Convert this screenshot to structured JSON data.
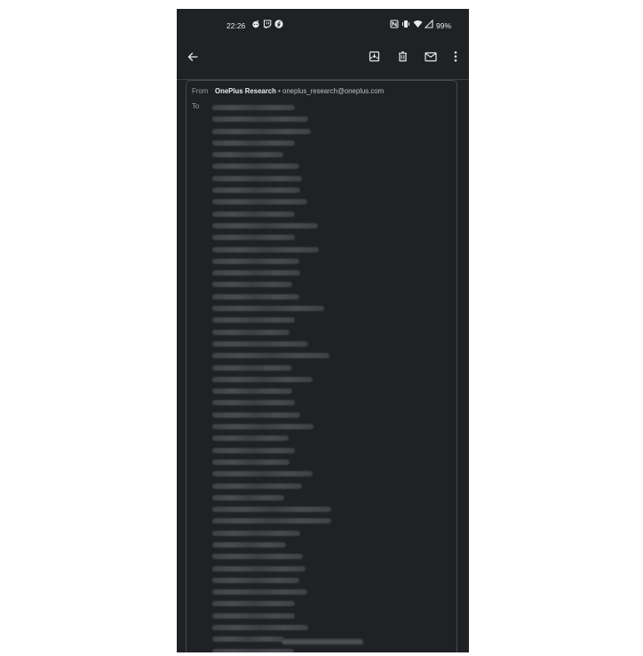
{
  "status_bar": {
    "time": "22:26",
    "battery": "99%",
    "left_icons": [
      "reddit-icon",
      "twitch-icon",
      "shazam-icon"
    ],
    "right_icons": [
      "nfc-icon",
      "vibrate-icon",
      "wifi-icon",
      "cell-signal-icon"
    ]
  },
  "app_bar": {
    "actions": [
      "back-arrow-icon",
      "archive-icon",
      "delete-icon",
      "mark-unread-icon",
      "more-vert-icon"
    ]
  },
  "details": {
    "from_label": "From",
    "sender_name": "OnePlus Research",
    "separator": "•",
    "sender_email": "oneplus_research@oneplus.com",
    "to_label": "To",
    "recipients_note": "redacted",
    "recipient_widths": [
      0.62,
      0.72,
      0.74,
      0.62,
      0.53,
      0.65,
      0.67,
      0.66,
      0.71,
      0.62,
      0.79,
      0.62,
      0.8,
      0.65,
      0.66,
      0.6,
      0.65,
      0.84,
      0.62,
      0.58,
      0.72,
      0.88,
      0.6,
      0.75,
      0.6,
      0.62,
      0.66,
      0.76,
      0.57,
      0.62,
      0.58,
      0.75,
      0.67,
      0.54,
      0.89,
      0.89,
      0.66,
      0.55,
      0.68,
      0.7,
      0.65,
      0.71,
      0.62,
      0.62,
      0.72,
      0.54,
      0.61
    ]
  },
  "colors": {
    "background": "#202124",
    "text_primary": "#e8eaed",
    "text_secondary": "#9aa0a6",
    "card_border": "#45484c"
  }
}
